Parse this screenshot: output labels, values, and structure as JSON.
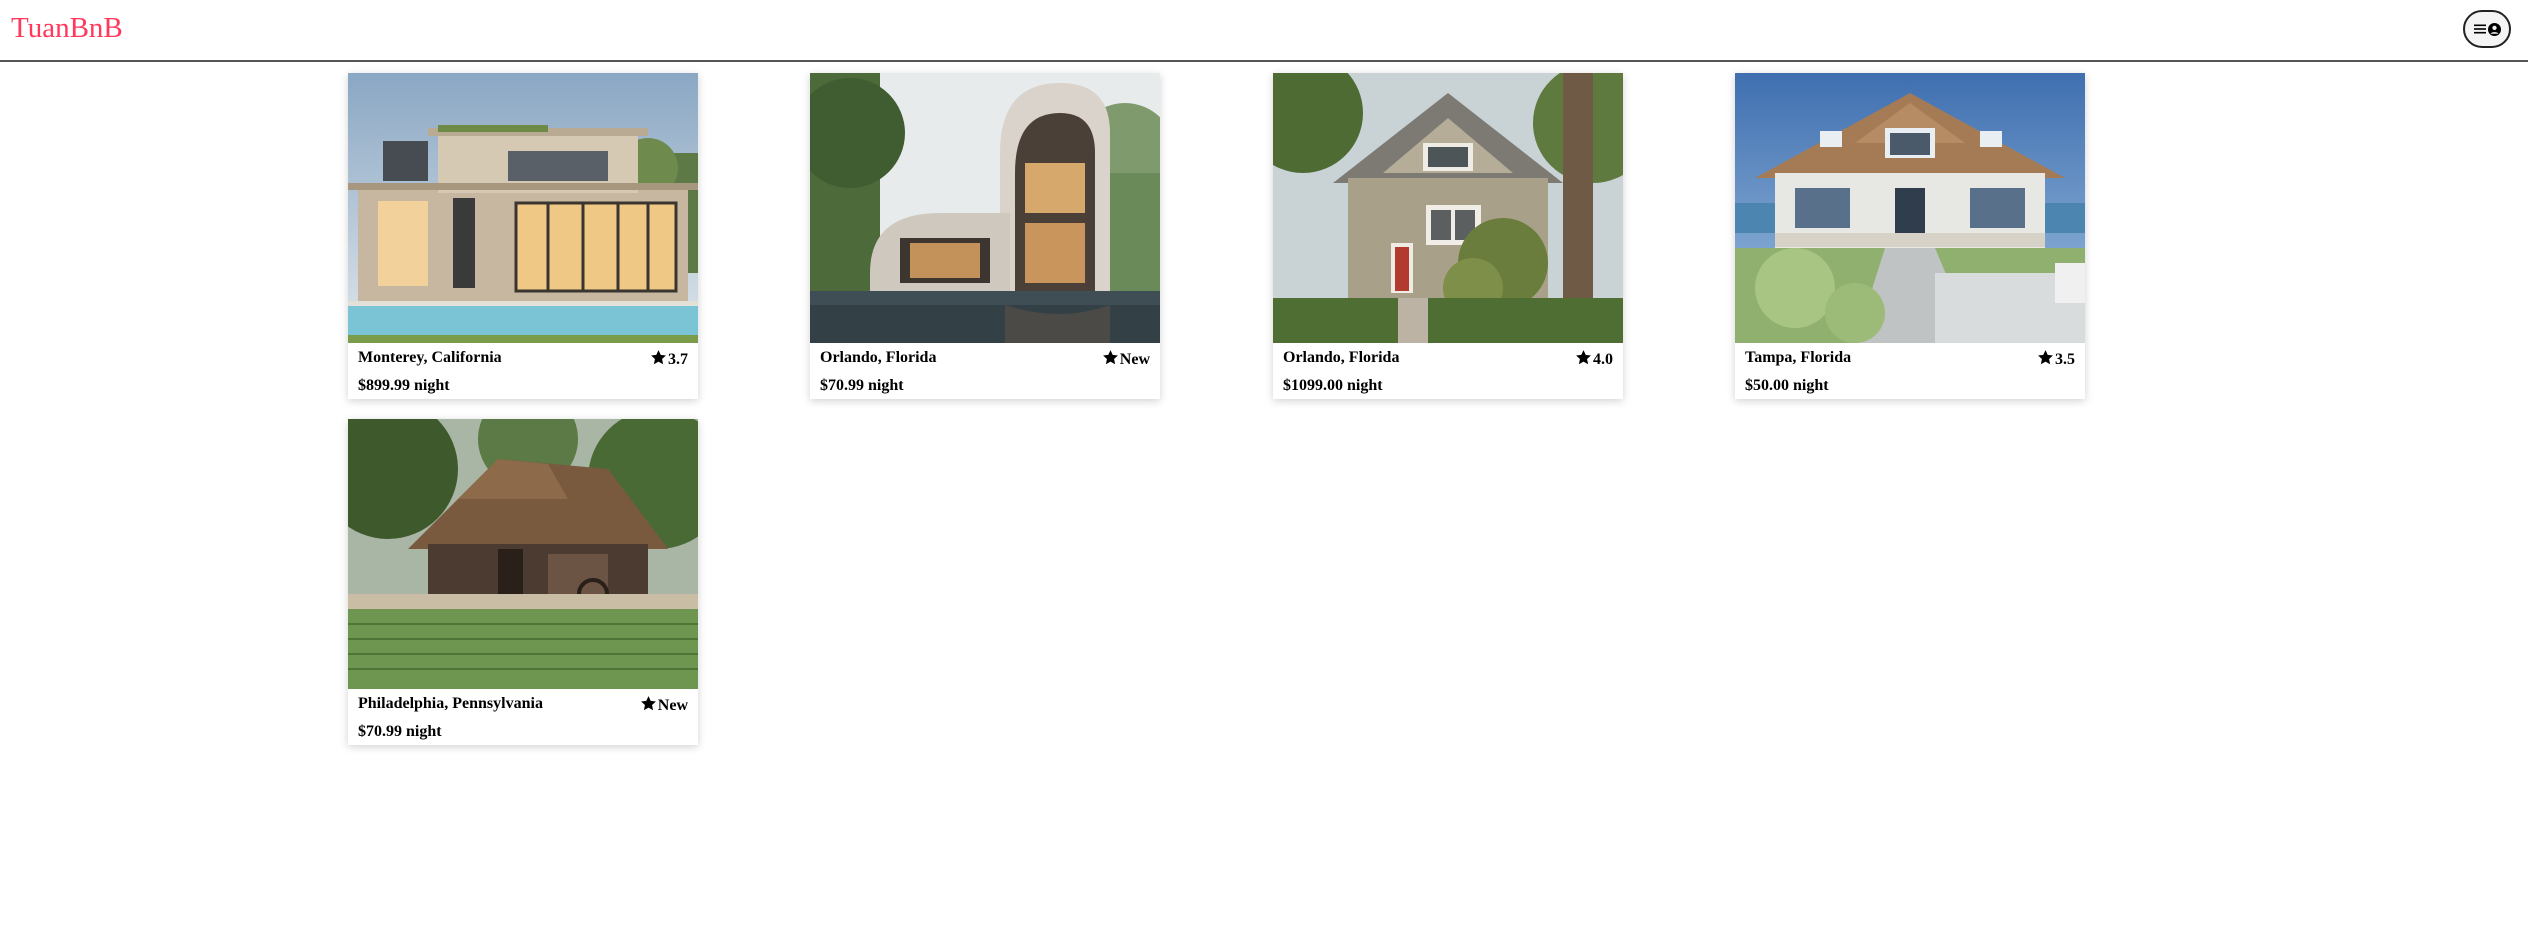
{
  "header": {
    "logo_text": "TuanBnB",
    "menu_icon": "hamburger-icon",
    "profile_icon": "user-circle-icon"
  },
  "colors": {
    "brand": "#ff385c"
  },
  "listings": [
    {
      "location": "Monterey, California",
      "rating": "3.7",
      "price": "$899.99 night",
      "image": "modern-villa-pool"
    },
    {
      "location": "Orlando, Florida",
      "rating": "New",
      "price": "$70.99 night",
      "image": "curved-modern-house"
    },
    {
      "location": "Orlando, Florida",
      "rating": "4.0",
      "price": "$1099.00 night",
      "image": "craftsman-house-tree"
    },
    {
      "location": "Tampa, Florida",
      "rating": "3.5",
      "price": "$50.00 night",
      "image": "beach-cottage"
    },
    {
      "location": "Philadelphia, Pennsylvania",
      "rating": "New",
      "price": "$70.99 night",
      "image": "thatched-farmhouse"
    }
  ]
}
